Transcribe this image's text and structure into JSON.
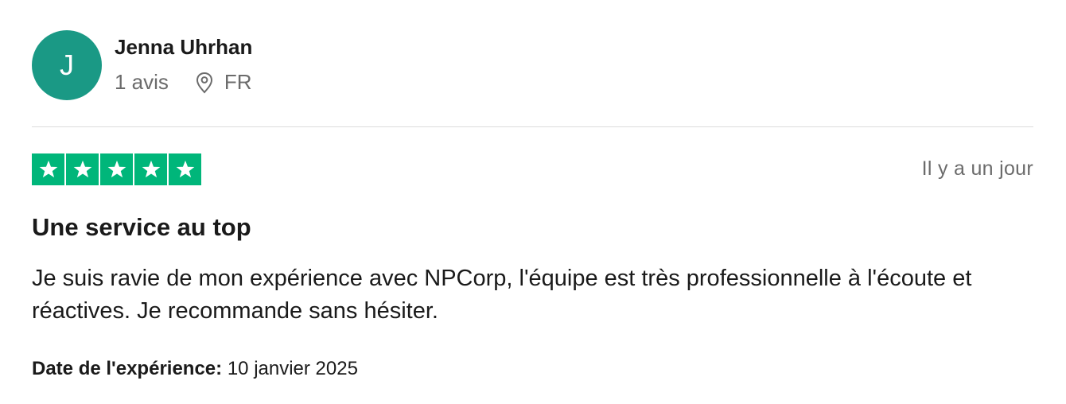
{
  "reviewer": {
    "avatar_initial": "J",
    "avatar_color": "#1a9985",
    "name": "Jenna Uhrhan",
    "review_count": "1 avis",
    "location_icon": "location-pin-icon",
    "country": "FR"
  },
  "review": {
    "rating": 5,
    "rating_max": 5,
    "star_color": "#00b67a",
    "relative_date": "Il y a un jour",
    "title": "Une service au top",
    "body": "Je suis ravie de mon expérience avec NPCorp, l'équipe est très professionnelle à l'écoute et réactives. Je recommande sans hésiter.",
    "experience_label": "Date de l'expérience:",
    "experience_date": "10 janvier 2025"
  }
}
